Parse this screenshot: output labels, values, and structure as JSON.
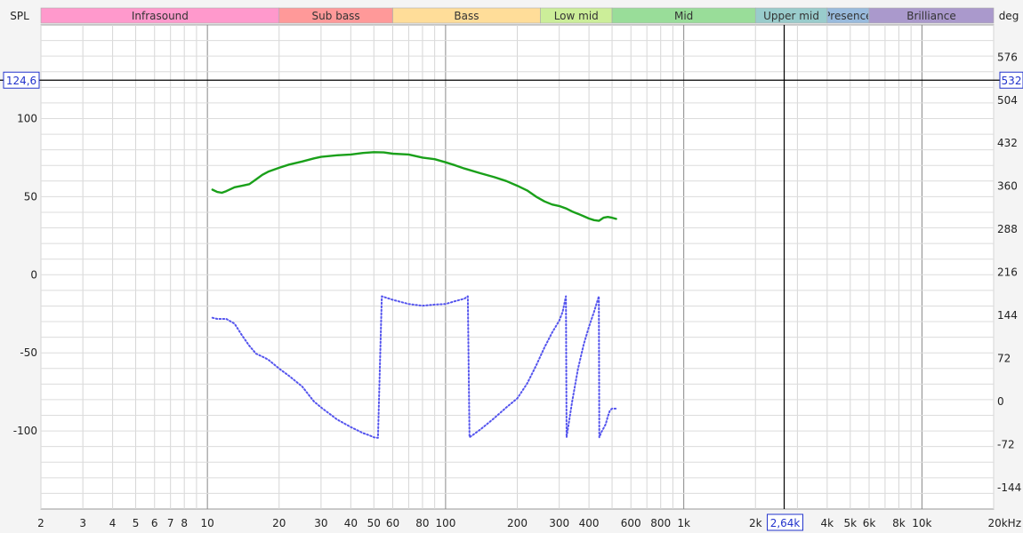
{
  "chart_data": {
    "type": "line",
    "xscale": "log",
    "xlim": [
      2,
      20000
    ],
    "y_left": {
      "label": "SPL",
      "lim": [
        -150,
        160
      ],
      "ticks": [
        -100,
        -50,
        0,
        50,
        100
      ]
    },
    "y_right": {
      "label": "deg",
      "lim": [
        -180,
        630
      ],
      "ticks": [
        -144,
        -72,
        0,
        72,
        144,
        216,
        288,
        360,
        432,
        504,
        576
      ]
    },
    "x_ticks": [
      {
        "v": 2,
        "label": "2"
      },
      {
        "v": 3,
        "label": "3"
      },
      {
        "v": 4,
        "label": "4"
      },
      {
        "v": 5,
        "label": "5"
      },
      {
        "v": 6,
        "label": "6"
      },
      {
        "v": 7,
        "label": "7"
      },
      {
        "v": 8,
        "label": "8"
      },
      {
        "v": 10,
        "label": "10"
      },
      {
        "v": 20,
        "label": "20"
      },
      {
        "v": 30,
        "label": "30"
      },
      {
        "v": 40,
        "label": "40"
      },
      {
        "v": 50,
        "label": "50"
      },
      {
        "v": 60,
        "label": "60"
      },
      {
        "v": 80,
        "label": "80"
      },
      {
        "v": 100,
        "label": "100"
      },
      {
        "v": 200,
        "label": "200"
      },
      {
        "v": 300,
        "label": "300"
      },
      {
        "v": 400,
        "label": "400"
      },
      {
        "v": 600,
        "label": "600"
      },
      {
        "v": 800,
        "label": "800"
      },
      {
        "v": 1000,
        "label": "1k"
      },
      {
        "v": 2000,
        "label": "2k"
      },
      {
        "v": 4000,
        "label": "4k"
      },
      {
        "v": 5000,
        "label": "5k"
      },
      {
        "v": 6000,
        "label": "6k"
      },
      {
        "v": 8000,
        "label": "8k"
      },
      {
        "v": 10000,
        "label": "10k"
      },
      {
        "v": 20000,
        "label": "20kHz"
      }
    ],
    "bands": [
      {
        "name": "Infrasound",
        "from": 2,
        "to": 20,
        "color": "#ff99cc"
      },
      {
        "name": "Sub bass",
        "from": 20,
        "to": 60,
        "color": "#ff9999"
      },
      {
        "name": "Bass",
        "from": 60,
        "to": 250,
        "color": "#ffdd99"
      },
      {
        "name": "Low mid",
        "from": 250,
        "to": 500,
        "color": "#ccee99"
      },
      {
        "name": "Mid",
        "from": 500,
        "to": 2000,
        "color": "#99dd99"
      },
      {
        "name": "Upper mid",
        "from": 2000,
        "to": 4000,
        "color": "#99cccc"
      },
      {
        "name": "Presence",
        "from": 4000,
        "to": 6000,
        "color": "#99bbdd"
      },
      {
        "name": "Brilliance",
        "from": 6000,
        "to": 20000,
        "color": "#aa99cc"
      }
    ],
    "cursor": {
      "x": 2640,
      "x_label": "2,64k",
      "y": 124.6,
      "y_label": "124,6",
      "y_right_label": "532"
    },
    "series": [
      {
        "axis": "left",
        "style": "solid",
        "color": "#1aa01a",
        "points": [
          [
            10.5,
            54.5
          ],
          [
            11,
            53
          ],
          [
            11.5,
            52.5
          ],
          [
            12,
            53.5
          ],
          [
            13,
            56
          ],
          [
            14,
            57
          ],
          [
            15,
            58
          ],
          [
            16,
            61
          ],
          [
            17,
            64
          ],
          [
            18,
            66
          ],
          [
            20,
            68.5
          ],
          [
            22,
            70.5
          ],
          [
            25,
            72.5
          ],
          [
            28,
            74.5
          ],
          [
            30,
            75.5
          ],
          [
            35,
            76.5
          ],
          [
            40,
            77
          ],
          [
            45,
            78
          ],
          [
            50,
            78.5
          ],
          [
            55,
            78.3
          ],
          [
            60,
            77.5
          ],
          [
            70,
            77
          ],
          [
            80,
            75
          ],
          [
            90,
            74
          ],
          [
            100,
            72
          ],
          [
            110,
            70
          ],
          [
            120,
            68
          ],
          [
            140,
            65
          ],
          [
            160,
            62.5
          ],
          [
            180,
            60
          ],
          [
            200,
            57
          ],
          [
            220,
            54
          ],
          [
            240,
            50
          ],
          [
            260,
            47
          ],
          [
            280,
            45
          ],
          [
            300,
            44
          ],
          [
            320,
            42.5
          ],
          [
            340,
            40.5
          ],
          [
            360,
            39
          ],
          [
            380,
            37.5
          ],
          [
            400,
            36
          ],
          [
            420,
            35
          ],
          [
            440,
            34.5
          ],
          [
            460,
            36.5
          ],
          [
            480,
            37
          ],
          [
            500,
            36.5
          ],
          [
            520,
            35.8
          ]
        ]
      },
      {
        "axis": "right",
        "style": "dotted",
        "color": "#5555ee",
        "points": [
          [
            10.5,
            140
          ],
          [
            11,
            138
          ],
          [
            12,
            138
          ],
          [
            13,
            130
          ],
          [
            14,
            110
          ],
          [
            15,
            93
          ],
          [
            16,
            80
          ],
          [
            17,
            75
          ],
          [
            18,
            70
          ],
          [
            20,
            55
          ],
          [
            22,
            43
          ],
          [
            25,
            25
          ],
          [
            28,
            0
          ],
          [
            30,
            -10
          ],
          [
            35,
            -30
          ],
          [
            40,
            -43
          ],
          [
            42,
            -47
          ],
          [
            45,
            -53
          ],
          [
            48,
            -57
          ],
          [
            50,
            -60
          ],
          [
            52,
            -61
          ],
          [
            54,
            176
          ],
          [
            60,
            170
          ],
          [
            70,
            163
          ],
          [
            80,
            160
          ],
          [
            90,
            162
          ],
          [
            100,
            163
          ],
          [
            110,
            168
          ],
          [
            120,
            172
          ],
          [
            124,
            176
          ],
          [
            126,
            -60
          ],
          [
            140,
            -47
          ],
          [
            160,
            -28
          ],
          [
            180,
            -10
          ],
          [
            200,
            5
          ],
          [
            220,
            30
          ],
          [
            240,
            60
          ],
          [
            260,
            90
          ],
          [
            280,
            115
          ],
          [
            300,
            135
          ],
          [
            310,
            150
          ],
          [
            320,
            176
          ],
          [
            322,
            -60
          ],
          [
            340,
            0
          ],
          [
            360,
            55
          ],
          [
            380,
            95
          ],
          [
            400,
            125
          ],
          [
            420,
            150
          ],
          [
            440,
            176
          ],
          [
            442,
            -60
          ],
          [
            450,
            -52
          ],
          [
            460,
            -45
          ],
          [
            470,
            -38
          ],
          [
            480,
            -25
          ],
          [
            490,
            -15
          ],
          [
            500,
            -12
          ],
          [
            520,
            -12
          ]
        ]
      }
    ]
  }
}
